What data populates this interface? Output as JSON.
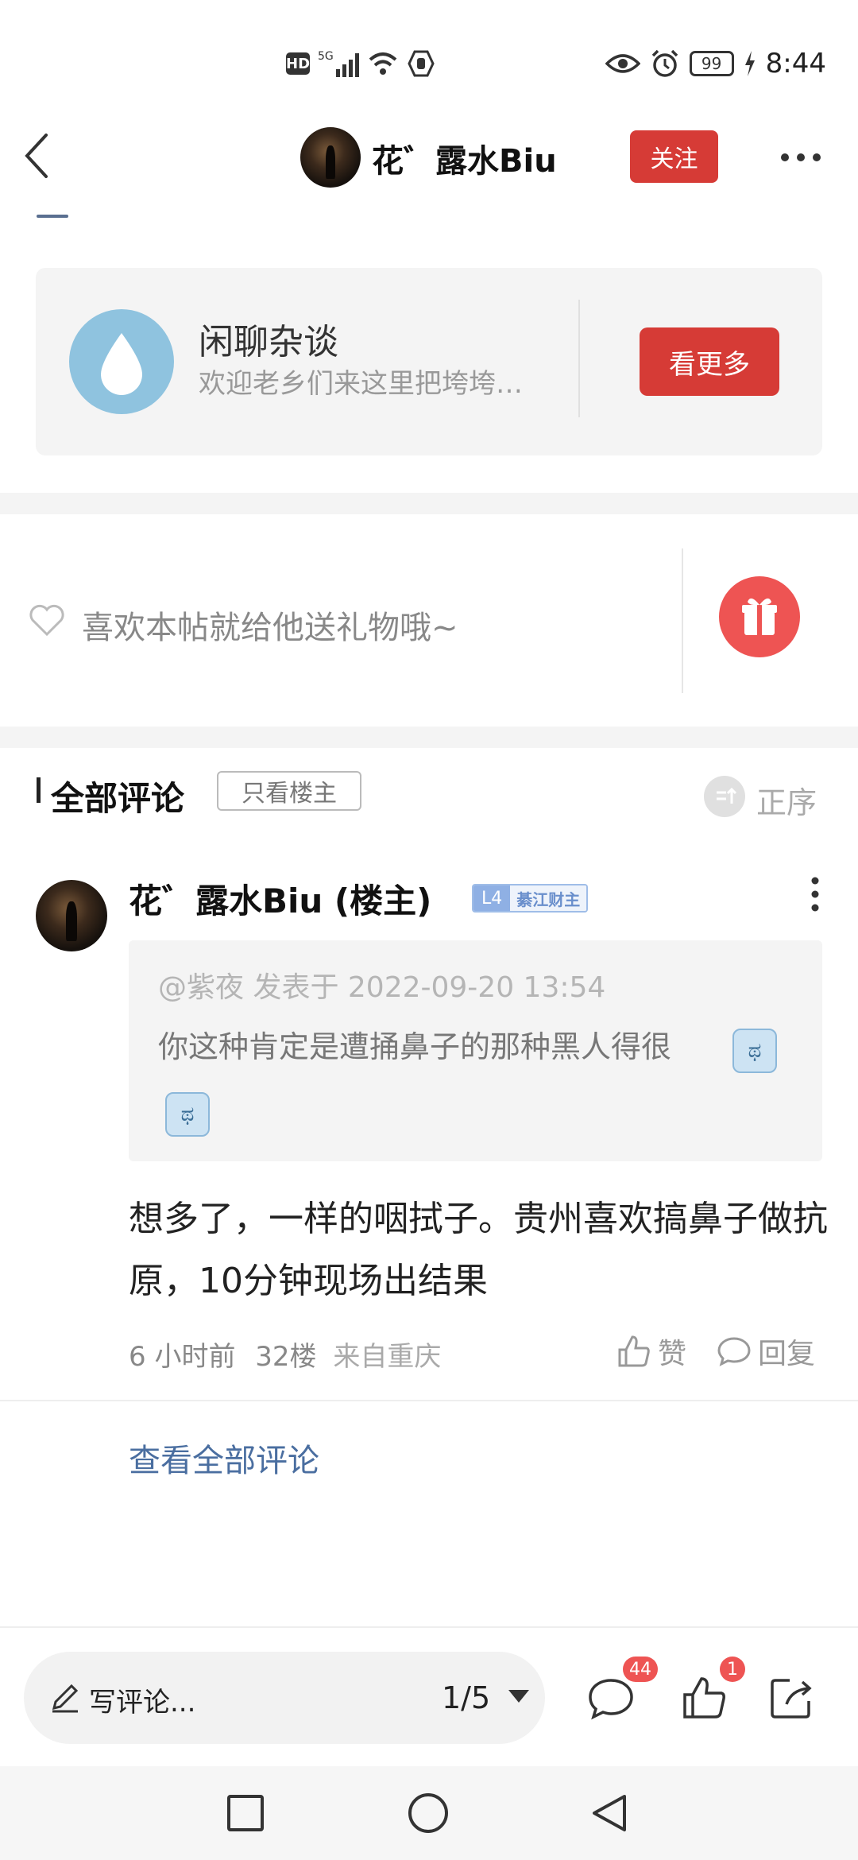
{
  "status_bar": {
    "hd": "HD",
    "signal": "5G",
    "battery": "99",
    "time": "8:44"
  },
  "nav": {
    "user_name": "花゛露水Biu",
    "follow_label": "关注"
  },
  "community": {
    "name": "闲聊杂谈",
    "description": "欢迎老乡们来这里把垮垮…",
    "more_label": "看更多"
  },
  "gift": {
    "prompt": "喜欢本帖就给他送礼物哦~"
  },
  "comments_header": {
    "title": "全部评论",
    "only_op_label": "只看楼主",
    "order_label": "正序"
  },
  "comment": {
    "author": "花゛露水Biu (楼主)",
    "level": "L4",
    "level_title": "綦江财主",
    "quote_meta": "@紫夜 发表于 2022-09-20 13:54",
    "quote_text": "你这种肯定是遭捅鼻子的那种黑人得很",
    "body": "想多了，一样的咽拭子。贵州喜欢搞鼻子做抗原，10分钟现场出结果",
    "time": "6 小时前",
    "floor": "32楼",
    "location": "来自重庆",
    "like_label": "赞",
    "reply_label": "回复"
  },
  "view_all_label": "查看全部评论",
  "toolbar": {
    "write_label": "写评论...",
    "page_indicator": "1/5",
    "comment_count": "44",
    "like_count": "1"
  },
  "colors": {
    "accent_red": "#d63b36",
    "link_blue": "#4a6ea0",
    "badge_red": "#ee5453"
  }
}
